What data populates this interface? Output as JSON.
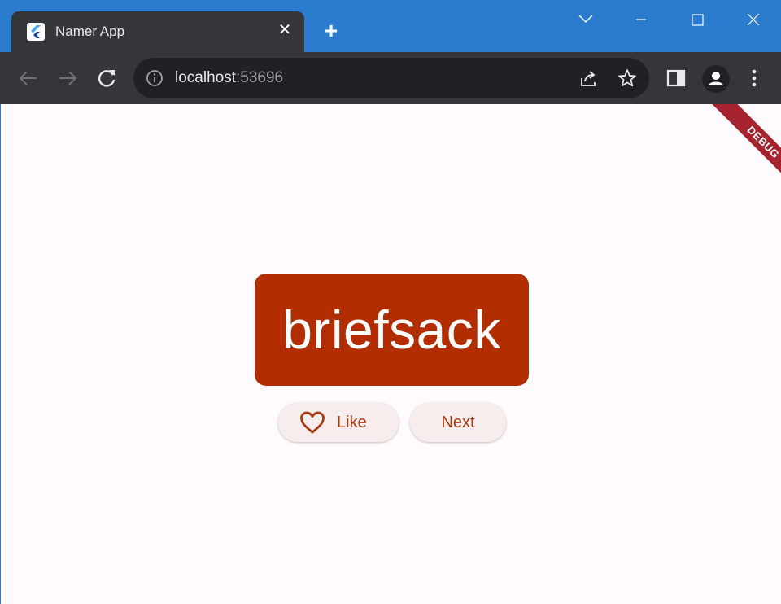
{
  "tab": {
    "title": "Namer App"
  },
  "address_bar": {
    "host": "localhost",
    "port": ":53696"
  },
  "debug_banner": "DEBUG",
  "word_card": {
    "text": "briefsack"
  },
  "buttons": {
    "like_label": "Like",
    "next_label": "Next"
  },
  "colors": {
    "card": "#b22d00",
    "button_text": "#a83a12",
    "background": "#fffbfe"
  }
}
